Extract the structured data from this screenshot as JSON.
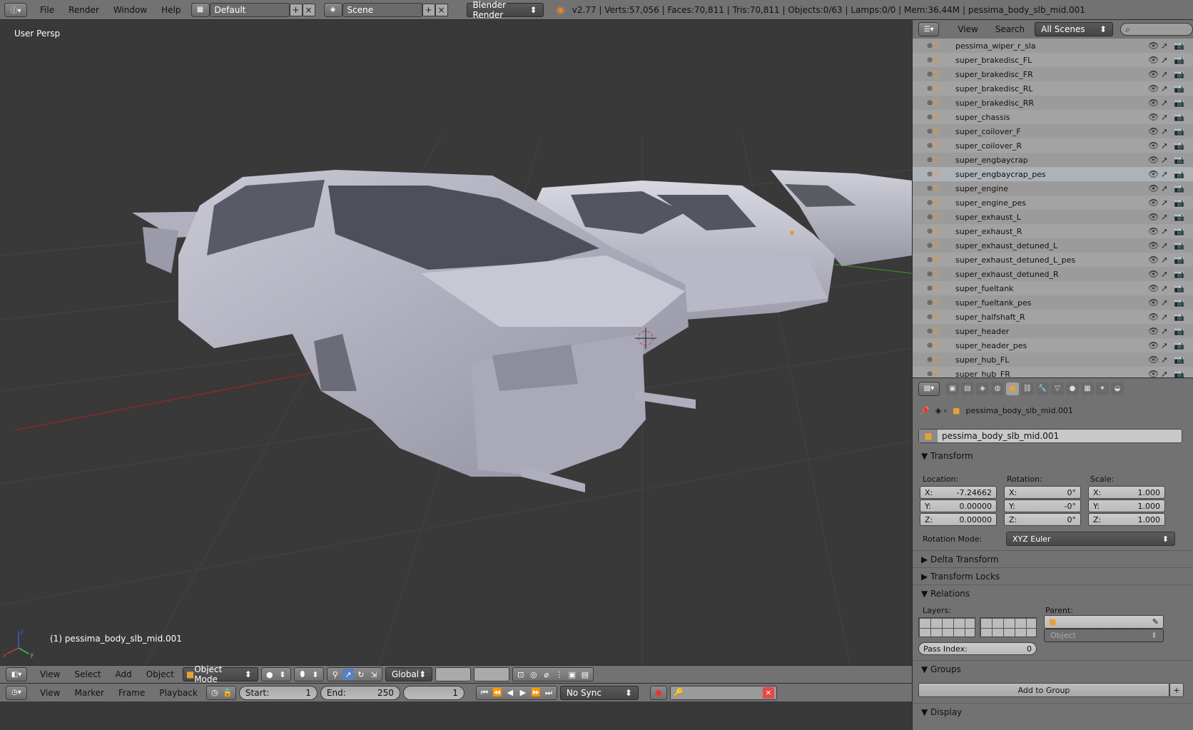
{
  "topbar": {
    "menus": [
      "File",
      "Render",
      "Window",
      "Help"
    ],
    "screen_layout": "Default",
    "scene": "Scene",
    "render_engine": "Blender Render",
    "stats": "v2.77 | Verts:57,056 | Faces:70,811 | Tris:70,811 | Objects:0/63 | Lamps:0/0 | Mem:36.44M | pessima_body_slb_mid.001"
  },
  "viewport": {
    "view_label": "User Persp",
    "object_label": "(1) pessima_body_slb_mid.001"
  },
  "view3d_header": {
    "menus": [
      "View",
      "Select",
      "Add",
      "Object"
    ],
    "mode": "Object Mode",
    "orientation": "Global"
  },
  "timeline_header": {
    "menus": [
      "View",
      "Marker",
      "Frame",
      "Playback"
    ],
    "start_label": "Start:",
    "start_value": "1",
    "end_label": "End:",
    "end_value": "250",
    "current_frame": "1",
    "sync": "No Sync"
  },
  "outliner": {
    "menus": [
      "View",
      "Search"
    ],
    "filter": "All Scenes",
    "items": [
      "pessima_wiper_r_sla",
      "super_brakedisc_FL",
      "super_brakedisc_FR",
      "super_brakedisc_RL",
      "super_brakedisc_RR",
      "super_chassis",
      "super_coilover_F",
      "super_coilover_R",
      "super_engbaycrap",
      "super_engbaycrap_pes",
      "super_engine",
      "super_engine_pes",
      "super_exhaust_L",
      "super_exhaust_R",
      "super_exhaust_detuned_L",
      "super_exhaust_detuned_L_pes",
      "super_exhaust_detuned_R",
      "super_fueltank",
      "super_fueltank_pes",
      "super_halfshaft_R",
      "super_header",
      "super_header_pes",
      "super_hub_FL",
      "super_hub_FR"
    ]
  },
  "properties": {
    "breadcrumb_object": "pessima_body_slb_mid.001",
    "object_name": "pessima_body_slb_mid.001",
    "transform_title": "Transform",
    "location_label": "Location:",
    "rotation_label": "Rotation:",
    "scale_label": "Scale:",
    "loc": [
      {
        "axis": "X:",
        "value": "-7.24662"
      },
      {
        "axis": "Y:",
        "value": "0.00000"
      },
      {
        "axis": "Z:",
        "value": "0.00000"
      }
    ],
    "rot": [
      {
        "axis": "X:",
        "value": "0°"
      },
      {
        "axis": "Y:",
        "value": "-0°"
      },
      {
        "axis": "Z:",
        "value": "0°"
      }
    ],
    "scl": [
      {
        "axis": "X:",
        "value": "1.000"
      },
      {
        "axis": "Y:",
        "value": "1.000"
      },
      {
        "axis": "Z:",
        "value": "1.000"
      }
    ],
    "rotation_mode_label": "Rotation Mode:",
    "rotation_mode": "XYZ Euler",
    "delta_transform": "Delta Transform",
    "transform_locks": "Transform Locks",
    "relations_title": "Relations",
    "layers_label": "Layers:",
    "parent_label": "Parent:",
    "parent_type": "Object",
    "pass_index_label": "Pass Index:",
    "pass_index": "0",
    "groups_title": "Groups",
    "add_to_group": "Add to Group",
    "display_title": "Display"
  }
}
